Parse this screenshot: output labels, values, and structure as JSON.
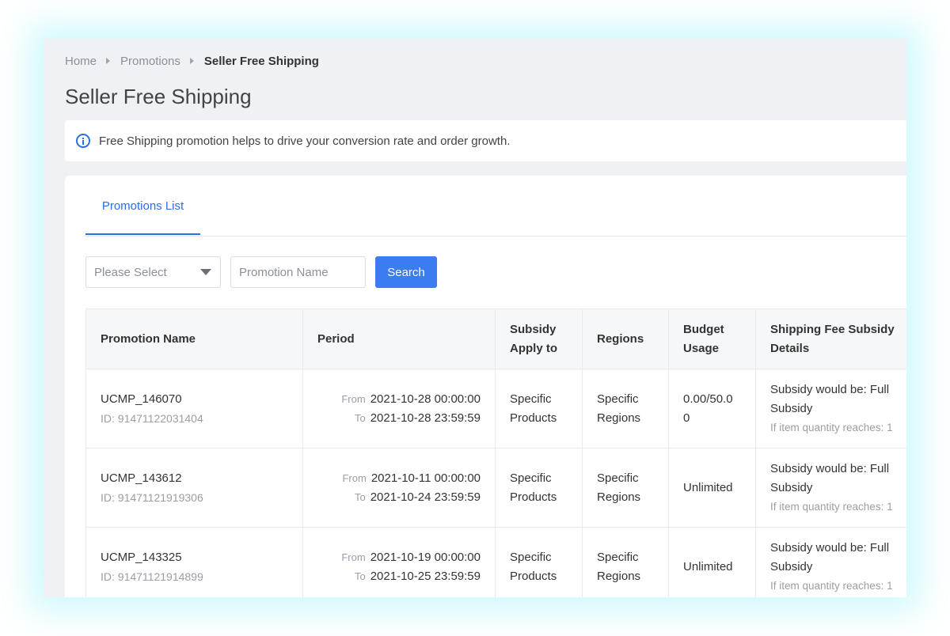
{
  "breadcrumb": {
    "home": "Home",
    "promotions": "Promotions",
    "current": "Seller Free Shipping"
  },
  "page_title": "Seller Free Shipping",
  "banner_text": "Free Shipping promotion helps to drive your conversion rate and order growth.",
  "tabs": [
    {
      "label": "Promotions List"
    }
  ],
  "filters": {
    "select_placeholder": "Please Select",
    "name_placeholder": "Promotion Name",
    "search_label": "Search"
  },
  "table": {
    "headers": {
      "name": "Promotion Name",
      "period": "Period",
      "subsidy_line1": "Subsidy",
      "subsidy_line2": "Apply to",
      "regions": "Regions",
      "budget_line1": "Budget",
      "budget_line2": "Usage",
      "details_line1": "Shipping Fee Subsidy",
      "details_line2": "Details"
    },
    "from_label": "From",
    "to_label": "To",
    "rows": [
      {
        "name": "UCMP_146070",
        "id": "ID: 91471122031404",
        "from": "2021-10-28 00:00:00",
        "to": "2021-10-28 23:59:59",
        "subsidy_line1": "Specific",
        "subsidy_line2": "Products",
        "regions_line1": "Specific",
        "regions_line2": "Regions",
        "budget_line1": "0.00/50.0",
        "budget_line2": "0",
        "detail_line1": "Subsidy would be: Full",
        "detail_line2": "Subsidy",
        "detail_sub": "If item quantity reaches: 1"
      },
      {
        "name": "UCMP_143612",
        "id": "ID: 91471121919306",
        "from": "2021-10-11 00:00:00",
        "to": "2021-10-24 23:59:59",
        "subsidy_line1": "Specific",
        "subsidy_line2": "Products",
        "regions_line1": "Specific",
        "regions_line2": "Regions",
        "budget_line1": "Unlimited",
        "budget_line2": "",
        "detail_line1": "Subsidy would be: Full",
        "detail_line2": "Subsidy",
        "detail_sub": "If item quantity reaches: 1"
      },
      {
        "name": "UCMP_143325",
        "id": "ID: 91471121914899",
        "from": "2021-10-19 00:00:00",
        "to": "2021-10-25 23:59:59",
        "subsidy_line1": "Specific",
        "subsidy_line2": "Products",
        "regions_line1": "Specific",
        "regions_line2": "Regions",
        "budget_line1": "Unlimited",
        "budget_line2": "",
        "detail_line1": "Subsidy would be: Full",
        "detail_line2": "Subsidy",
        "detail_sub": "If item quantity reaches: 1"
      }
    ]
  },
  "colors": {
    "accent": "#3b7cf0",
    "page_bg": "#f0f1f5",
    "glow": "#c8f8fc"
  }
}
